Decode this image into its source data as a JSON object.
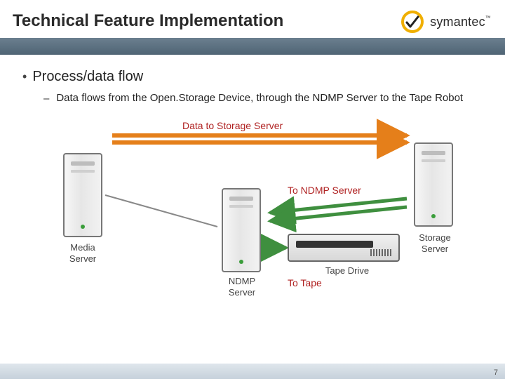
{
  "brand": {
    "name": "symantec",
    "tm": "™"
  },
  "title": "Technical Feature Implementation",
  "bullet": "Process/data flow",
  "sub_bullet": "Data flows from the Open.Storage Device, through the NDMP Server to the Tape Robot",
  "diagram": {
    "devices": {
      "media": "Media\nServer",
      "ndmp": "NDMP\nServer",
      "storage": "Storage\nServer",
      "tape_drive": "Tape Drive"
    },
    "flows": {
      "to_storage": "Data to Storage Server",
      "to_ndmp": "To NDMP Server",
      "to_tape": "To Tape"
    }
  },
  "page_number": "7"
}
